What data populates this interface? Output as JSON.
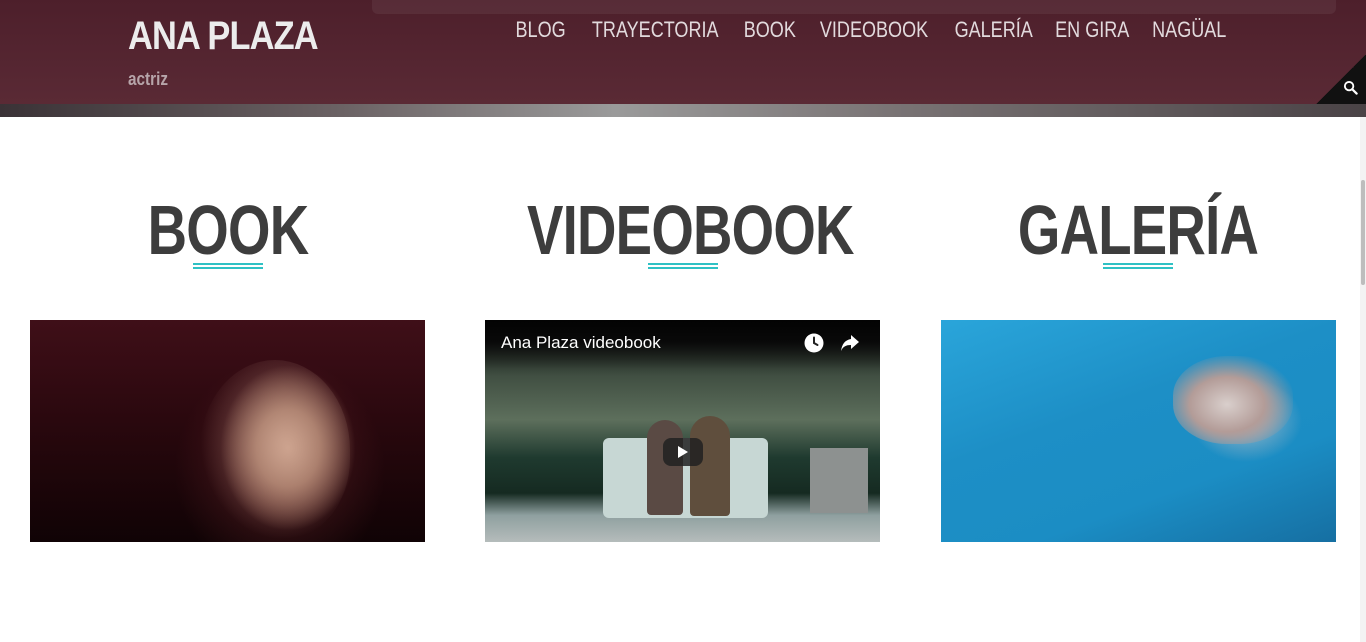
{
  "header": {
    "title": "ANA PLAZA",
    "tagline": "actriz",
    "nav": [
      {
        "label": "BLOG"
      },
      {
        "label": "TRAYECTORIA"
      },
      {
        "label": "BOOK"
      },
      {
        "label": "VIDEOBOOK"
      },
      {
        "label": "GALERÍA"
      },
      {
        "label": "EN GIRA"
      },
      {
        "label": "NAGÜAL"
      }
    ],
    "search_icon": "search-icon",
    "colors": {
      "bar": "#4d1f2b",
      "accent": "#2ec1c4"
    }
  },
  "sections": [
    {
      "heading": "BOOK",
      "media": "image"
    },
    {
      "heading": "VIDEOBOOK",
      "media": "video",
      "video_title": "Ana Plaza videobook"
    },
    {
      "heading": "GALERÍA",
      "media": "image"
    }
  ],
  "video_controls": {
    "watch_later_icon": "clock-icon",
    "share_icon": "share-icon",
    "play_icon": "play-icon"
  }
}
